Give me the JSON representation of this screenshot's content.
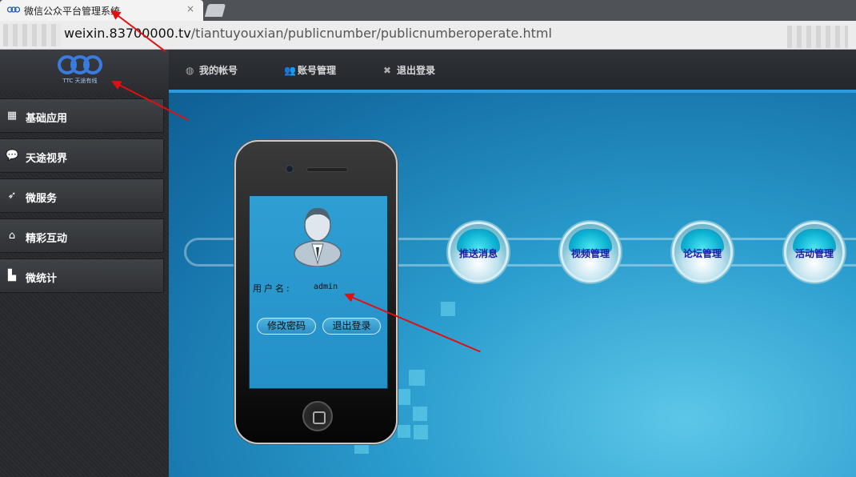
{
  "browser": {
    "tab_title": "微信公众平台管理系统",
    "tab_close": "×",
    "url_host": "weixin.83700000.tv",
    "url_path": "/tiantuyouxian/publicnumber/publicnumberoperate.html"
  },
  "topnav": {
    "items": [
      {
        "icon": "globe-icon",
        "label": "我的帐号"
      },
      {
        "icon": "users-icon",
        "label": "账号管理"
      },
      {
        "icon": "close-x-icon",
        "label": "退出登录"
      }
    ]
  },
  "logo": {
    "text": "TTC 天途有线"
  },
  "sidebar": {
    "items": [
      {
        "icon": "grid-icon",
        "label": "基础应用"
      },
      {
        "icon": "chat-bubbles-icon",
        "label": "天途视界"
      },
      {
        "icon": "rocket-icon",
        "label": "微服务"
      },
      {
        "icon": "home-icon",
        "label": "精彩互动"
      },
      {
        "icon": "bar-chart-icon",
        "label": "微统计"
      }
    ]
  },
  "phone": {
    "user_label": "用户名:",
    "user_value": "admin",
    "change_password": "修改密码",
    "logout": "退出登录"
  },
  "modules": {
    "items": [
      {
        "label": "推送消息"
      },
      {
        "label": "视频管理"
      },
      {
        "label": "论坛管理"
      },
      {
        "label": "活动管理"
      }
    ]
  },
  "colors": {
    "accent_blue": "#2b9bdc",
    "module_label": "#1c1aa8",
    "annotation_red": "#e01010"
  }
}
